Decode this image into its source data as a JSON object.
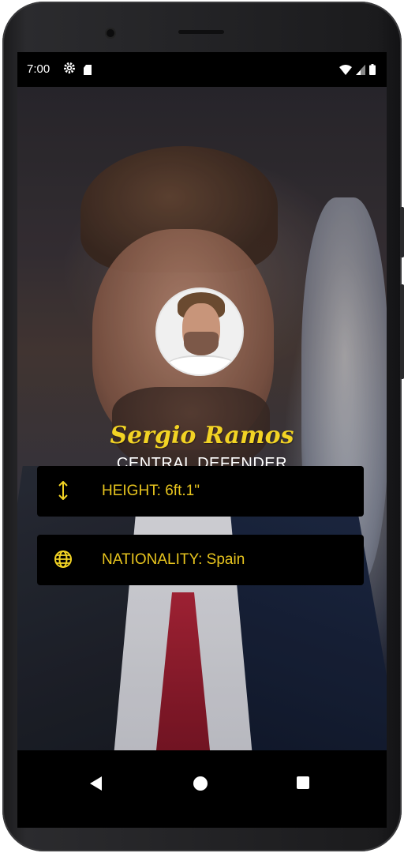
{
  "status_bar": {
    "time": "7:00",
    "icons": [
      "gear-icon",
      "sd-card-icon",
      "wifi-icon",
      "signal-icon",
      "battery-icon"
    ]
  },
  "profile": {
    "name": "Sergio Ramos",
    "position": "CENTRAL DEFENDER",
    "accent_color": "#f2d324"
  },
  "info_items": [
    {
      "icon": "height-arrows-icon",
      "label": "HEIGHT: 6ft.1\""
    },
    {
      "icon": "globe-icon",
      "label": "NATIONALITY: Spain"
    }
  ],
  "nav_bar": {
    "buttons": [
      "back-icon",
      "home-icon",
      "recents-icon"
    ]
  }
}
